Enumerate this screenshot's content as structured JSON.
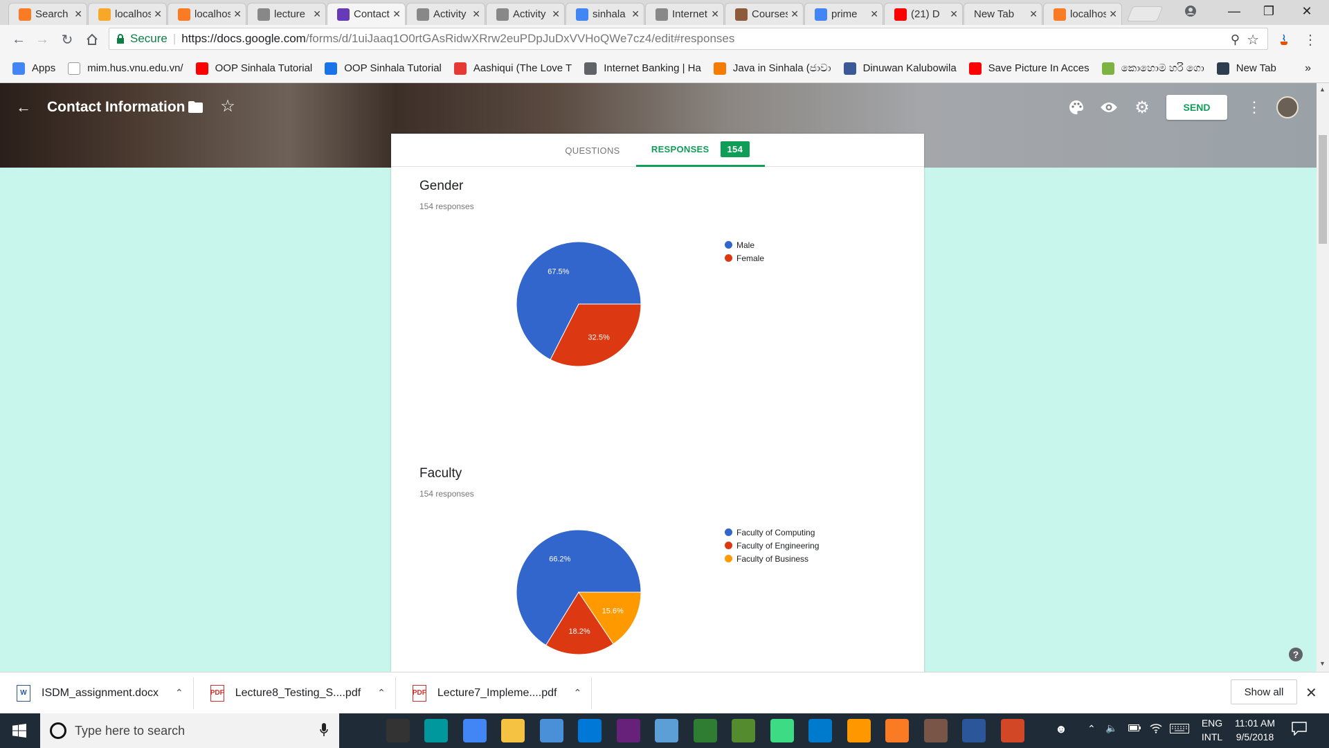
{
  "browser": {
    "tabs": [
      {
        "title": "Search",
        "icon": "xampp-icon",
        "color": "#fb7a24",
        "active": false
      },
      {
        "title": "localhost",
        "icon": "pma-icon",
        "color": "#f8a828",
        "active": false
      },
      {
        "title": "localhost",
        "icon": "xampp-icon",
        "color": "#fb7a24",
        "active": false
      },
      {
        "title": "lecture",
        "icon": "doc-icon",
        "color": "#888888",
        "active": false
      },
      {
        "title": "Contact",
        "icon": "forms-icon",
        "color": "#673ab7",
        "active": true
      },
      {
        "title": "Activity",
        "icon": "doc-icon",
        "color": "#888888",
        "active": false
      },
      {
        "title": "Activity",
        "icon": "doc-icon",
        "color": "#888888",
        "active": false
      },
      {
        "title": "sinhala",
        "icon": "google-icon",
        "color": "#4285f4",
        "active": false
      },
      {
        "title": "Internet",
        "icon": "doc-icon",
        "color": "#888888",
        "active": false
      },
      {
        "title": "Courses",
        "icon": "course-icon",
        "color": "#8e5a3c",
        "active": false
      },
      {
        "title": "prime",
        "icon": "google-icon",
        "color": "#4285f4",
        "active": false
      },
      {
        "title": "(21) D",
        "icon": "youtube-icon",
        "color": "#ff0000",
        "active": false
      },
      {
        "title": "New Tab",
        "icon": "",
        "color": "#e8e8e8",
        "active": false
      },
      {
        "title": "localhost",
        "icon": "xampp-icon",
        "color": "#fb7a24",
        "active": false
      }
    ],
    "secure_label": "Secure",
    "url_base": "https://docs.google.com",
    "url_path": "/forms/d/1uiJaaq1O0rtGAsRidwXRrw2euPDpJuDxVVHoQWe7cz4/edit#responses",
    "bookmarks": [
      {
        "label": "Apps",
        "icon": "apps-icon",
        "color": "#4285f4"
      },
      {
        "label": "mim.hus.vnu.edu.vn/",
        "icon": "doc-icon",
        "color": "#ffffff"
      },
      {
        "label": "OOP Sinhala Tutorial",
        "icon": "youtube-icon",
        "color": "#ff0000"
      },
      {
        "label": "OOP Sinhala Tutorial",
        "icon": "l-icon",
        "color": "#1a73e8"
      },
      {
        "label": "Aashiqui (The Love T",
        "icon": "g-icon",
        "color": "#e53935"
      },
      {
        "label": "Internet Banking | Ha",
        "icon": "bank-icon",
        "color": "#5f6368"
      },
      {
        "label": "Java in Sinhala (ජාවා",
        "icon": "blogger-icon",
        "color": "#f57c00"
      },
      {
        "label": "Dinuwan Kalubowila",
        "icon": "facebook-icon",
        "color": "#3b5998"
      },
      {
        "label": "Save Picture In Acces",
        "icon": "youtube-icon",
        "color": "#ff0000"
      },
      {
        "label": "කොහොම හරි ගො",
        "icon": "windows-icon",
        "color": "#7cb342"
      },
      {
        "label": "New Tab",
        "icon": "w3-icon",
        "color": "#2c3e50"
      }
    ]
  },
  "form": {
    "title": "Contact Information",
    "send_label": "SEND",
    "tab_questions": "QUESTIONS",
    "tab_responses": "RESPONSES",
    "response_count": "154"
  },
  "questions": [
    {
      "title": "Gender",
      "subtitle": "154 responses"
    },
    {
      "title": "Faculty",
      "subtitle": "154 responses"
    }
  ],
  "chart_data": [
    {
      "type": "pie",
      "title": "Gender",
      "categories": [
        "Male",
        "Female"
      ],
      "values": [
        67.5,
        32.5
      ],
      "labels": [
        "67.5%",
        "32.5%"
      ],
      "colors": [
        "#3366cc",
        "#dc3912"
      ],
      "legend": "right"
    },
    {
      "type": "pie",
      "title": "Faculty",
      "categories": [
        "Faculty of Computing",
        "Faculty of Engineering",
        "Faculty of Business"
      ],
      "values": [
        66.2,
        18.2,
        15.6
      ],
      "labels": [
        "66.2%",
        "18.2%",
        "15.6%"
      ],
      "colors": [
        "#3366cc",
        "#dc3912",
        "#ff9900"
      ],
      "legend": "right"
    }
  ],
  "downloads": {
    "items": [
      {
        "name": "ISDM_assignment.docx",
        "icon": "word-file-icon",
        "color": "#2b579a"
      },
      {
        "name": "Lecture8_Testing_S....pdf",
        "icon": "pdf-file-icon",
        "color": "#d32f2f"
      },
      {
        "name": "Lecture7_Impleme....pdf",
        "icon": "pdf-file-icon",
        "color": "#d32f2f"
      }
    ],
    "show_all_label": "Show all"
  },
  "taskbar": {
    "search_placeholder": "Type here to search",
    "apps": [
      {
        "name": "task-view-icon",
        "color": "#1f2b36"
      },
      {
        "name": "terminal-icon",
        "color": "#333333"
      },
      {
        "name": "arduino-icon",
        "color": "#00979d"
      },
      {
        "name": "chrome-icon",
        "color": "#4285f4"
      },
      {
        "name": "file-explorer-icon",
        "color": "#f5c242"
      },
      {
        "name": "virtualbox-icon",
        "color": "#4a90d9"
      },
      {
        "name": "store-icon",
        "color": "#0078d7"
      },
      {
        "name": "visual-studio-icon",
        "color": "#68217a"
      },
      {
        "name": "paint-icon",
        "color": "#5c9ed6"
      },
      {
        "name": "snipping-icon",
        "color": "#2e7d32"
      },
      {
        "name": "image-icon",
        "color": "#558b2f"
      },
      {
        "name": "android-studio-icon",
        "color": "#3ddc84"
      },
      {
        "name": "vscode-icon",
        "color": "#007acc"
      },
      {
        "name": "sublime-icon",
        "color": "#ff9800"
      },
      {
        "name": "xampp-icon",
        "color": "#fb7a24"
      },
      {
        "name": "tools-icon",
        "color": "#795548"
      },
      {
        "name": "word-icon",
        "color": "#2b579a"
      },
      {
        "name": "powerpoint-icon",
        "color": "#d24726"
      }
    ],
    "lang_line1": "ENG",
    "lang_line2": "INTL",
    "time": "11:01 AM",
    "date": "9/5/2018"
  }
}
